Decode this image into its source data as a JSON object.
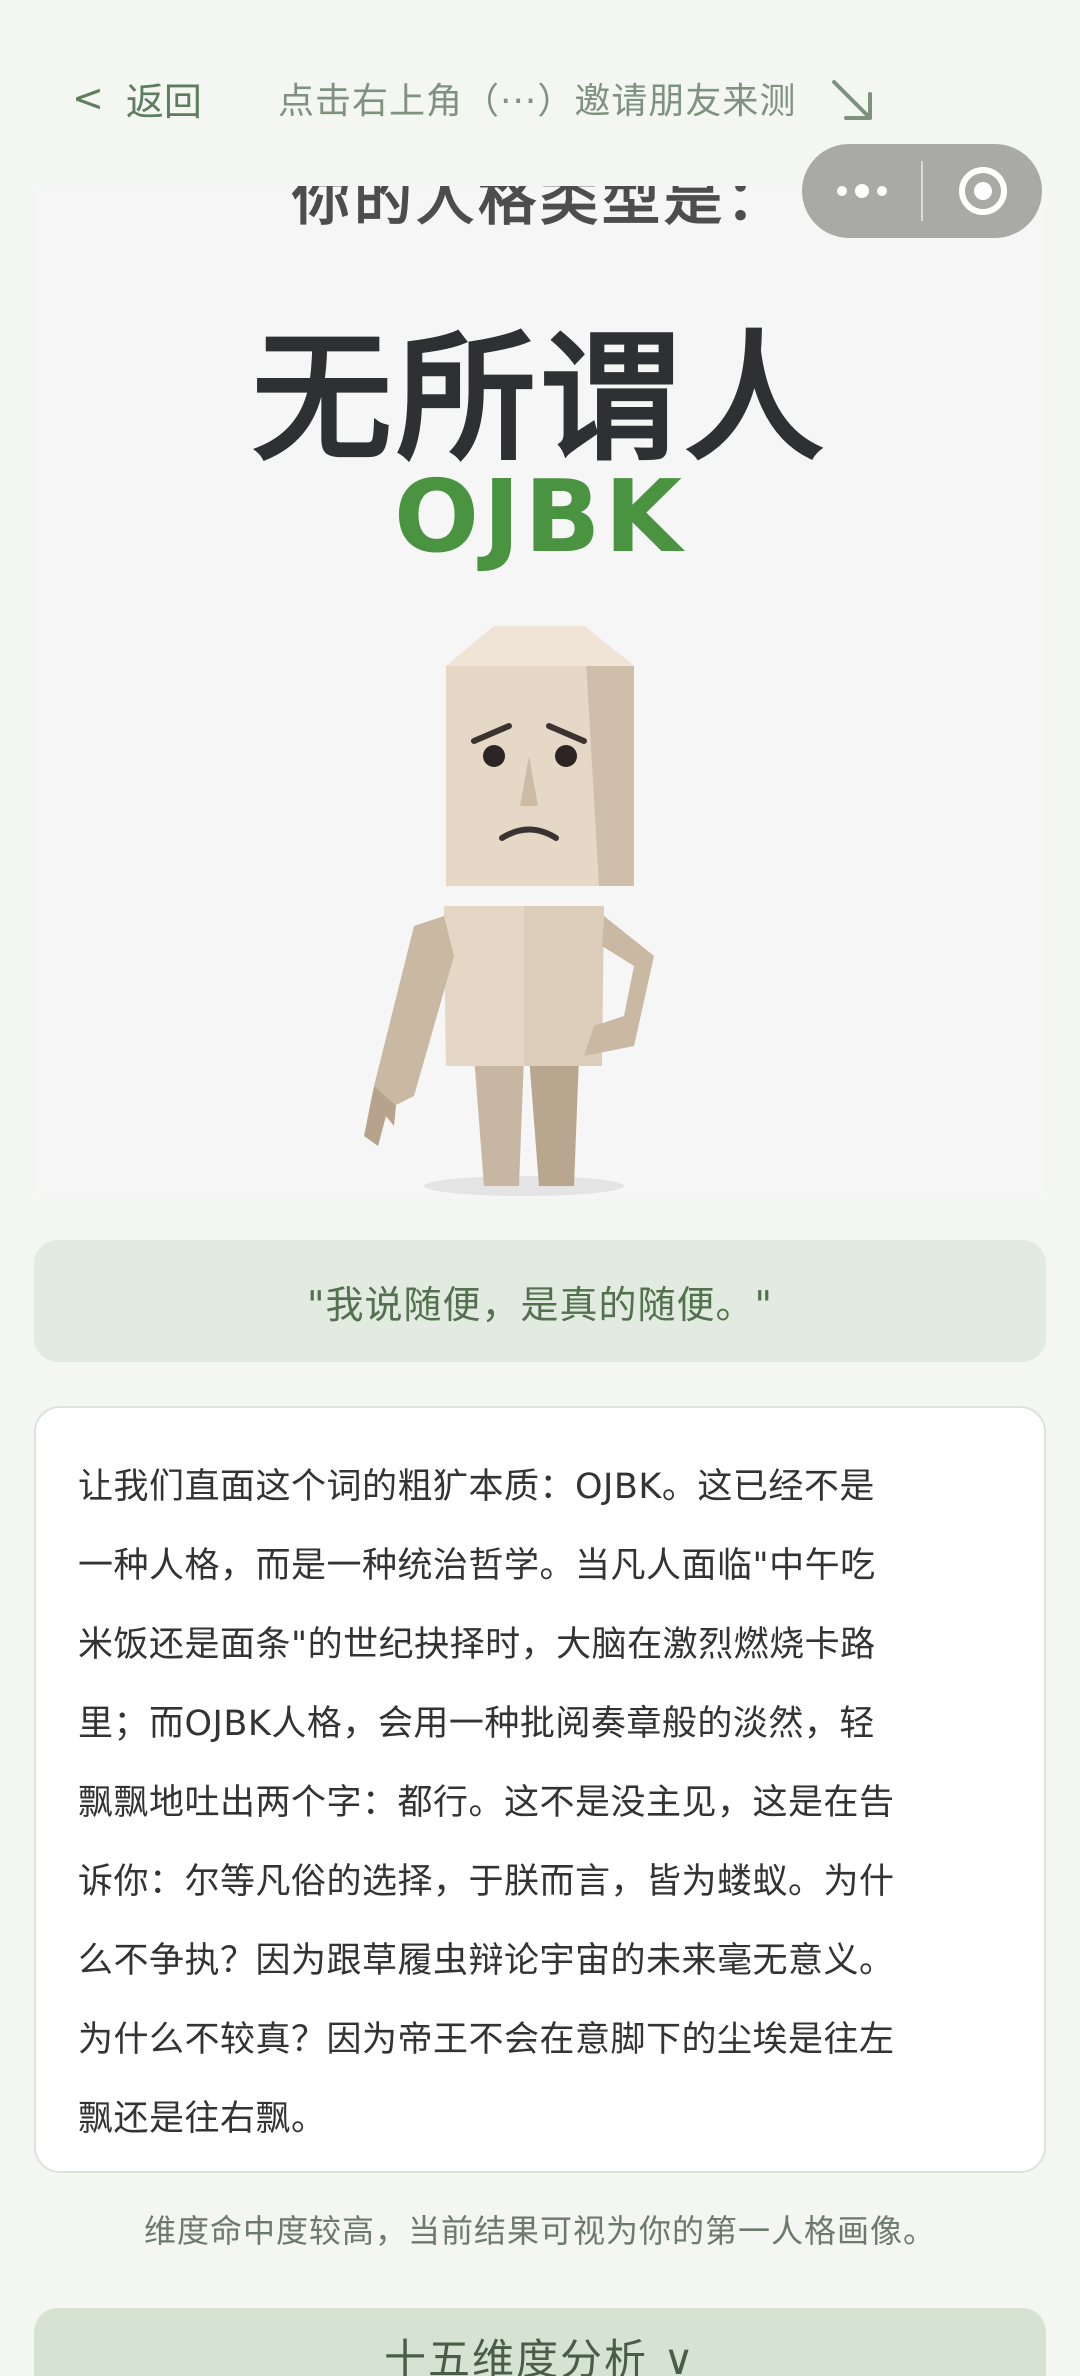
{
  "nav": {
    "back_label": "返回",
    "invite_tip": "点击右上角（···）邀请朋友来测"
  },
  "result_image": {
    "top_text": "你的人格类型是：",
    "title": "无所谓人",
    "code": "OJBK",
    "figure_icon": "cube-person-figure"
  },
  "quote": "\"我说随便，是真的随便。\"",
  "description_lines": [
    "让我们直面这个词的粗犷本质：OJBK。这已经不是",
    "一种人格，而是一种统治哲学。当凡人面临\"中午吃",
    "米饭还是面条\"的世纪抉择时，大脑在激烈燃烧卡路",
    "里；而OJBK人格，会用一种批阅奏章般的淡然，轻",
    "飘飘地吐出两个字：都行。这不是没主见，这是在告",
    "诉你：尔等凡俗的选择，于朕而言，皆为蝼蚁。为什",
    "么不争执？因为跟草履虫辩论宇宙的未来毫无意义。",
    "为什么不较真？因为帝王不会在意脚下的尘埃是往左",
    "飘还是往右飘。"
  ],
  "confidence_note": "维度命中度较高，当前结果可视为你的第一人格画像。",
  "analysis_button": "十五维度分析 ∨",
  "colors": {
    "background": "#f3f6f1",
    "accent_green": "#4a9340",
    "quote_bg": "#e2ebdf",
    "button_bg": "#d6e2d2"
  }
}
